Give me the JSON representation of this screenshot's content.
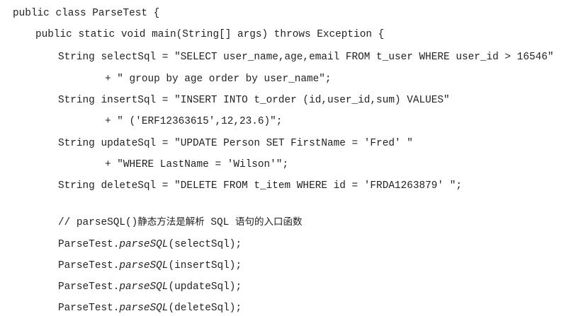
{
  "code": {
    "class_decl": "public class ParseTest {",
    "main_decl": "public static void main(String[] args) throws Exception {",
    "select_1": "String selectSql = \"SELECT user_name,age,email FROM t_user WHERE user_id > 16546\"",
    "select_2": "+ \" group by age order by user_name\";",
    "insert_1": "String insertSql = \"INSERT INTO t_order (id,user_id,sum) VALUES\"",
    "insert_2": "+ \" ('ERF12363615',12,23.6)\";",
    "update_1": "String updateSql = \"UPDATE Person SET FirstName = 'Fred' \"",
    "update_2": "+ \"WHERE LastName = 'Wilson'\";",
    "delete_1": "String deleteSql = \"DELETE FROM t_item WHERE id = 'FRDA1263879' \";",
    "comment_prefix": "// parseSQL()",
    "comment_cjk": "静态方法是解析",
    "comment_sql": " SQL ",
    "comment_cjk_2": "语句的入口函数",
    "call_class": "ParseTest.",
    "call_method": "parseSQL",
    "call_select": "(selectSql);",
    "call_insert": "(insertSql);",
    "call_update": "(updateSql);",
    "call_delete": "(deleteSql);"
  }
}
